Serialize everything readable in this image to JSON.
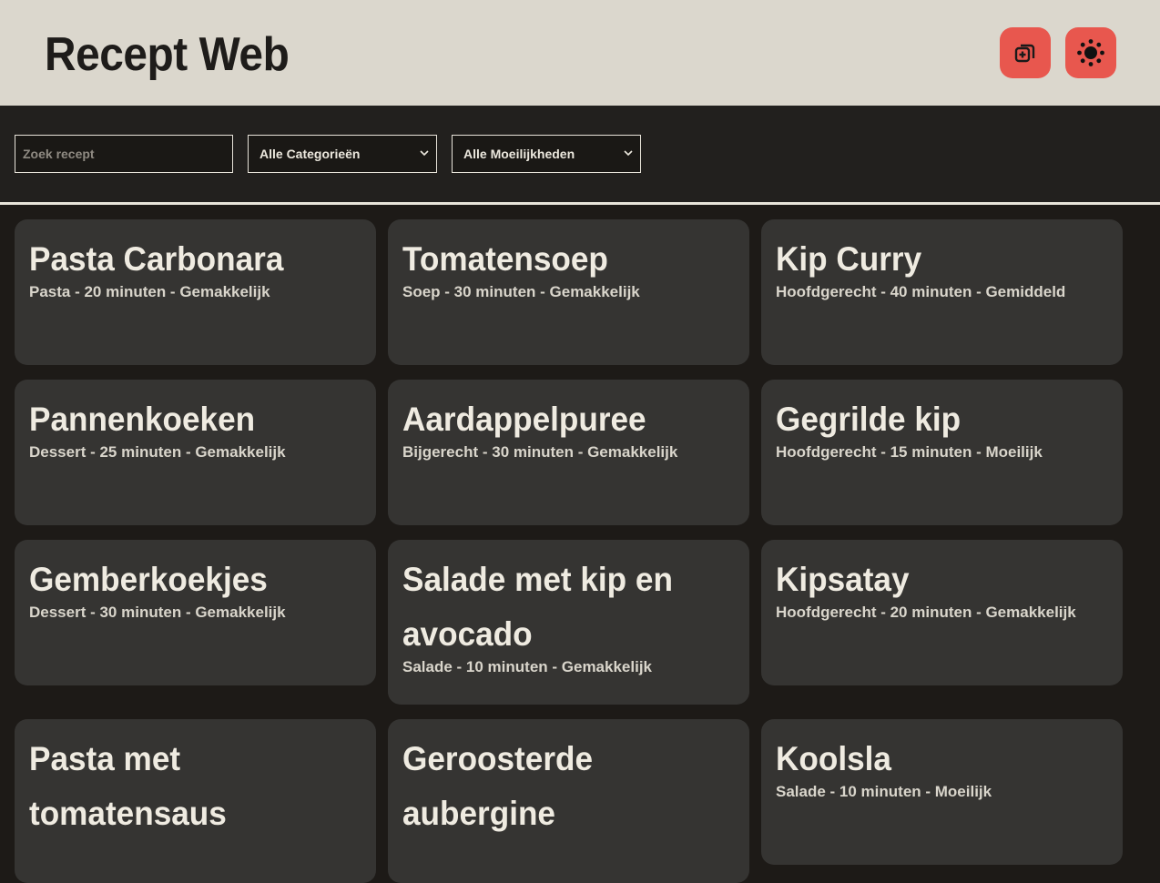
{
  "header": {
    "title": "Recept Web",
    "add_button_icon": "add-copy-icon",
    "theme_button_icon": "sun-icon",
    "accent": "#e8574e"
  },
  "filters": {
    "search_placeholder": "Zoek recept",
    "category_selected": "Alle Categorieën",
    "difficulty_selected": "Alle Moeilijkheden"
  },
  "recipes": [
    {
      "title": "Pasta Carbonara",
      "meta": "Pasta - 20 minuten - Gemakkelijk"
    },
    {
      "title": "Tomatensoep",
      "meta": "Soep - 30 minuten - Gemakkelijk"
    },
    {
      "title": "Kip Curry",
      "meta": "Hoofdgerecht - 40 minuten - Gemiddeld"
    },
    {
      "title": "Pannenkoeken",
      "meta": "Dessert - 25 minuten - Gemakkelijk"
    },
    {
      "title": "Aardappelpuree",
      "meta": "Bijgerecht - 30 minuten - Gemakkelijk"
    },
    {
      "title": "Gegrilde kip",
      "meta": "Hoofdgerecht - 15 minuten - Moeilijk"
    },
    {
      "title": "Gemberkoekjes",
      "meta": "Dessert - 30 minuten - Gemakkelijk"
    },
    {
      "title": "Salade met kip en avocado",
      "meta": "Salade - 10 minuten - Gemakkelijk"
    },
    {
      "title": "Kipsatay",
      "meta": "Hoofdgerecht - 20 minuten - Gemakkelijk"
    },
    {
      "title": "Pasta met tomatensaus",
      "meta": ""
    },
    {
      "title": "Geroosterde aubergine",
      "meta": ""
    },
    {
      "title": "Koolsla",
      "meta": "Salade - 10 minuten - Moeilijk"
    }
  ]
}
